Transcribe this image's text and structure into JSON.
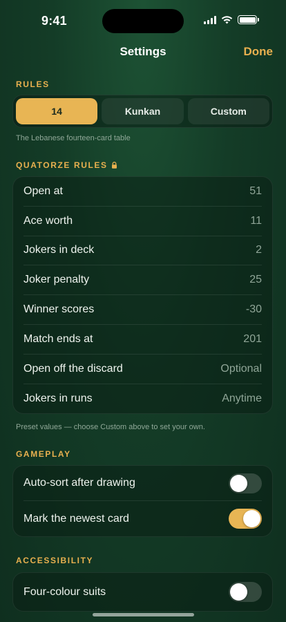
{
  "status_bar": {
    "time": "9:41"
  },
  "nav": {
    "title": "Settings",
    "done_label": "Done"
  },
  "rules_section": {
    "header": "RULES",
    "options": [
      "14",
      "Kunkan",
      "Custom"
    ],
    "selected": "14",
    "caption": "The Lebanese fourteen-card table"
  },
  "quatorze_section": {
    "header": "QUATORZE RULES",
    "locked_icon": "lock-icon",
    "rows": [
      {
        "label": "Open at",
        "value": "51"
      },
      {
        "label": "Ace worth",
        "value": "11"
      },
      {
        "label": "Jokers in deck",
        "value": "2"
      },
      {
        "label": "Joker penalty",
        "value": "25"
      },
      {
        "label": "Winner scores",
        "value": "-30"
      },
      {
        "label": "Match ends at",
        "value": "201"
      },
      {
        "label": "Open off the discard",
        "value": "Optional"
      },
      {
        "label": "Jokers in runs",
        "value": "Anytime"
      }
    ],
    "caption": "Preset values — choose Custom above to set your own."
  },
  "gameplay_section": {
    "header": "GAMEPLAY",
    "rows": [
      {
        "label": "Auto-sort after drawing",
        "on": false
      },
      {
        "label": "Mark the newest card",
        "on": true
      }
    ]
  },
  "accessibility_section": {
    "header": "ACCESSIBILITY",
    "rows": [
      {
        "label": "Four-colour suits",
        "on": false
      }
    ]
  },
  "colors": {
    "accent": "#e8b04f",
    "background": "#143c27",
    "toggle_on": "#e8b554"
  }
}
